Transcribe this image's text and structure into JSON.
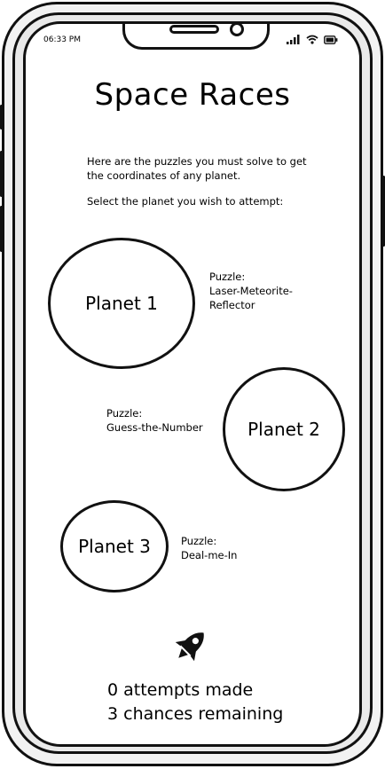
{
  "status_bar": {
    "time": "06:33 PM",
    "signal_icon": "signal-icon",
    "wifi_icon": "wifi-icon",
    "battery_icon": "battery-icon"
  },
  "title": "Space Races",
  "intro_text": "Here are the puzzles you must solve to get the coordinates of any planet.",
  "instruction": "Select the planet you wish to attempt:",
  "planets": [
    {
      "label": "Planet 1",
      "puzzle_heading": "Puzzle:",
      "puzzle_name": "Laser-Meteorite-Reflector"
    },
    {
      "label": "Planet 2",
      "puzzle_heading": "Puzzle:",
      "puzzle_name": "Guess-the-Number"
    },
    {
      "label": "Planet 3",
      "puzzle_heading": "Puzzle:",
      "puzzle_name": "Deal-me-In"
    }
  ],
  "rocket_icon": "rocket-icon",
  "stats": {
    "attempts": "0 attempts made",
    "chances": "3 chances remaining"
  }
}
